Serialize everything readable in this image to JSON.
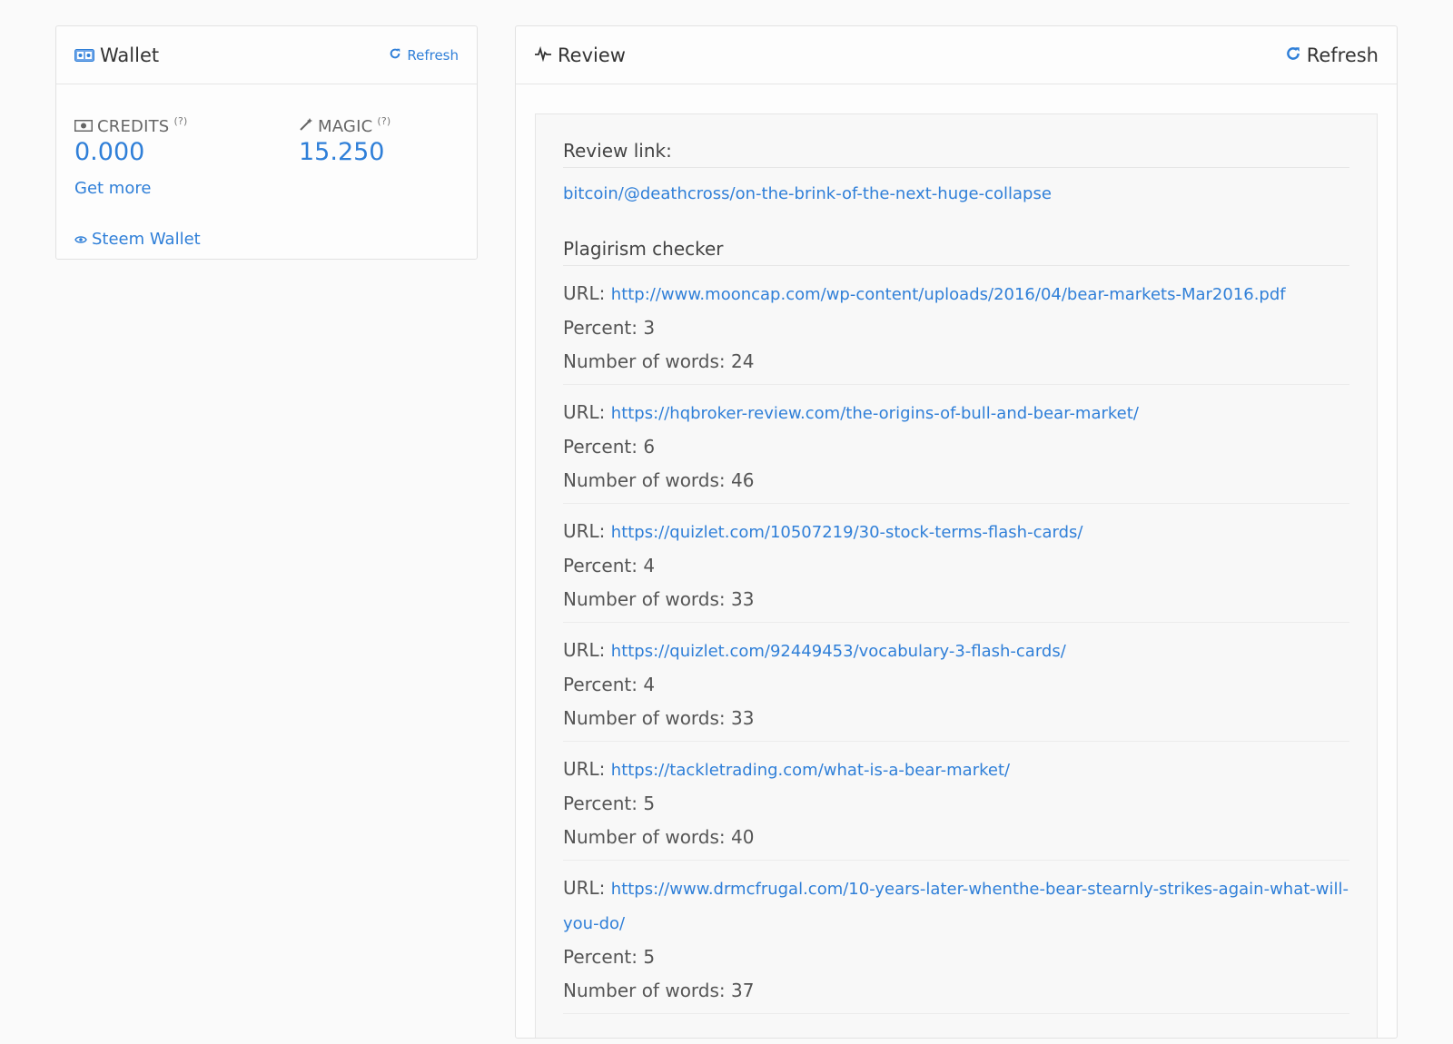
{
  "wallet": {
    "title": "Wallet",
    "refresh_label": "Refresh",
    "credits": {
      "label": "CREDITS",
      "help": "(?)",
      "value": "0.000"
    },
    "magic": {
      "label": "MAGIC",
      "help": "(?)",
      "value": "15.250"
    },
    "get_more": "Get more",
    "steem_wallet": "Steem Wallet",
    "icons": {
      "title": "wallet-icon",
      "refresh": "refresh-icon",
      "credits": "banknote-icon",
      "magic": "magic-wand-icon",
      "steem": "eye-icon"
    }
  },
  "review": {
    "title": "Review",
    "refresh_label": "Refresh",
    "review_link_heading": "Review link:",
    "review_link": "bitcoin/@deathcross/on-the-brink-of-the-next-huge-collapse",
    "plagiarism_heading": "Plagirism checker",
    "url_label": "URL:",
    "entries": [
      {
        "url": "http://www.mooncap.com/wp-content/uploads/2016/04/bear-markets-Mar2016.pdf",
        "percent": "Percent: 3",
        "words": "Number of words: 24"
      },
      {
        "url": "https://hqbroker-review.com/the-origins-of-bull-and-bear-market/",
        "percent": "Percent: 6",
        "words": "Number of words: 46"
      },
      {
        "url": "https://quizlet.com/10507219/30-stock-terms-flash-cards/",
        "percent": "Percent: 4",
        "words": "Number of words: 33"
      },
      {
        "url": "https://quizlet.com/92449453/vocabulary-3-flash-cards/",
        "percent": "Percent: 4",
        "words": "Number of words: 33"
      },
      {
        "url": "https://tackletrading.com/what-is-a-bear-market/",
        "percent": "Percent: 5",
        "words": "Number of words: 40"
      },
      {
        "url": "https://www.drmcfrugal.com/10-years-later-whenthe-bear-stearnly-strikes-again-what-will-you-do/",
        "percent": "Percent: 5",
        "words": "Number of words: 37"
      }
    ],
    "icons": {
      "title": "pulse-icon",
      "refresh": "refresh-icon"
    },
    "accent": "#2f7fd8"
  }
}
